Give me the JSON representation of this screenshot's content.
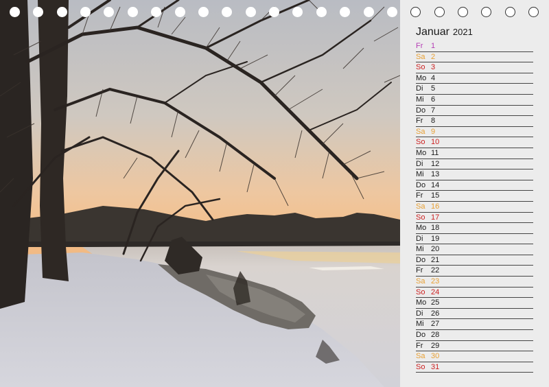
{
  "calendar": {
    "month": "Januar",
    "year": "2021",
    "colors": {
      "weekday": "#1a1a1a",
      "saturday": "#e8a034",
      "sunday": "#cc1f1f",
      "holiday": "#b43cb4"
    },
    "days": [
      {
        "wd": "Fr",
        "d": "1",
        "type": "holiday"
      },
      {
        "wd": "Sa",
        "d": "2",
        "type": "saturday"
      },
      {
        "wd": "So",
        "d": "3",
        "type": "sunday"
      },
      {
        "wd": "Mo",
        "d": "4",
        "type": "weekday"
      },
      {
        "wd": "Di",
        "d": "5",
        "type": "weekday"
      },
      {
        "wd": "Mi",
        "d": "6",
        "type": "weekday"
      },
      {
        "wd": "Do",
        "d": "7",
        "type": "weekday"
      },
      {
        "wd": "Fr",
        "d": "8",
        "type": "weekday"
      },
      {
        "wd": "Sa",
        "d": "9",
        "type": "saturday"
      },
      {
        "wd": "So",
        "d": "10",
        "type": "sunday"
      },
      {
        "wd": "Mo",
        "d": "11",
        "type": "weekday"
      },
      {
        "wd": "Di",
        "d": "12",
        "type": "weekday"
      },
      {
        "wd": "Mi",
        "d": "13",
        "type": "weekday"
      },
      {
        "wd": "Do",
        "d": "14",
        "type": "weekday"
      },
      {
        "wd": "Fr",
        "d": "15",
        "type": "weekday"
      },
      {
        "wd": "Sa",
        "d": "16",
        "type": "saturday"
      },
      {
        "wd": "So",
        "d": "17",
        "type": "sunday"
      },
      {
        "wd": "Mo",
        "d": "18",
        "type": "weekday"
      },
      {
        "wd": "Di",
        "d": "19",
        "type": "weekday"
      },
      {
        "wd": "Mi",
        "d": "20",
        "type": "weekday"
      },
      {
        "wd": "Do",
        "d": "21",
        "type": "weekday"
      },
      {
        "wd": "Fr",
        "d": "22",
        "type": "weekday"
      },
      {
        "wd": "Sa",
        "d": "23",
        "type": "saturday"
      },
      {
        "wd": "So",
        "d": "24",
        "type": "sunday"
      },
      {
        "wd": "Mo",
        "d": "25",
        "type": "weekday"
      },
      {
        "wd": "Di",
        "d": "26",
        "type": "weekday"
      },
      {
        "wd": "Mi",
        "d": "27",
        "type": "weekday"
      },
      {
        "wd": "Do",
        "d": "28",
        "type": "weekday"
      },
      {
        "wd": "Fr",
        "d": "29",
        "type": "weekday"
      },
      {
        "wd": "Sa",
        "d": "30",
        "type": "saturday"
      },
      {
        "wd": "So",
        "d": "31",
        "type": "sunday"
      }
    ]
  }
}
